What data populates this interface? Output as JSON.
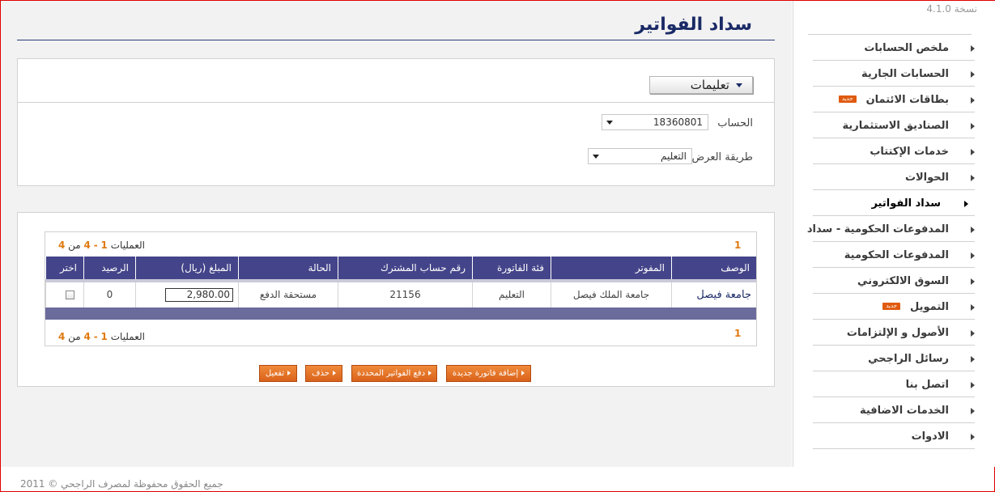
{
  "version": "نسخة 4.1.0",
  "sidebar": {
    "items": [
      {
        "label": "ملخص الحسابات",
        "badge": ""
      },
      {
        "label": "الحسابات الجارية",
        "badge": ""
      },
      {
        "label": "بطاقات الائتمان",
        "badge": "جديد"
      },
      {
        "label": "الصناديق الاستثمارية",
        "badge": ""
      },
      {
        "label": "خدمات الإكتتاب",
        "badge": ""
      },
      {
        "label": "الحوالات",
        "badge": ""
      },
      {
        "label": "سداد الفواتير",
        "badge": ""
      },
      {
        "label": "المدفوعات الحكومية - سداد",
        "badge": ""
      },
      {
        "label": "المدفوعات الحكومية",
        "badge": ""
      },
      {
        "label": "السوق الالكتروني",
        "badge": ""
      },
      {
        "label": "التمويل",
        "badge": "جديد"
      },
      {
        "label": "الأصول و الإلتزامات",
        "badge": ""
      },
      {
        "label": "رسائل الراجحي",
        "badge": ""
      },
      {
        "label": "اتصل بنا",
        "badge": ""
      },
      {
        "label": "الخدمات الاضافية",
        "badge": ""
      },
      {
        "label": "الادوات",
        "badge": ""
      }
    ],
    "active_index": 6
  },
  "page": {
    "title": "سداد الفواتير"
  },
  "form": {
    "instructions_label": "تعليمات",
    "account_label": "الحساب",
    "account_value": "18360801",
    "display_method_label": "طريقة العرض",
    "display_method_value": "التعليم"
  },
  "grid": {
    "pager_text": "العمليات",
    "range_start": "1",
    "range_sep": "-",
    "range_end": "4",
    "of_text": "من",
    "total": "4",
    "page": "1",
    "columns": [
      "الوصف",
      "المفوتر",
      "فئة الفاتورة",
      "رقم حساب المشترك",
      "الحالة",
      "المبلغ (ريال)",
      "الرصيد",
      "اختر"
    ],
    "rows": [
      {
        "description": "جامعة فيصل",
        "biller": "جامعة الملك فيصل",
        "category": "التعليم",
        "subscriber_account": "21156",
        "status": "مستحقة الدفع",
        "amount": "2,980.00",
        "balance": "0",
        "selected": false
      }
    ]
  },
  "actions": {
    "add_bill": "إضافة فاتورة جديدة",
    "pay_selected": "دفع الفواتير المحددة",
    "delete": "حذف",
    "activate": "تفعيل"
  },
  "footer": {
    "copyright": "جميع الحقوق محفوظة لمصرف الراجحي © 2011"
  }
}
